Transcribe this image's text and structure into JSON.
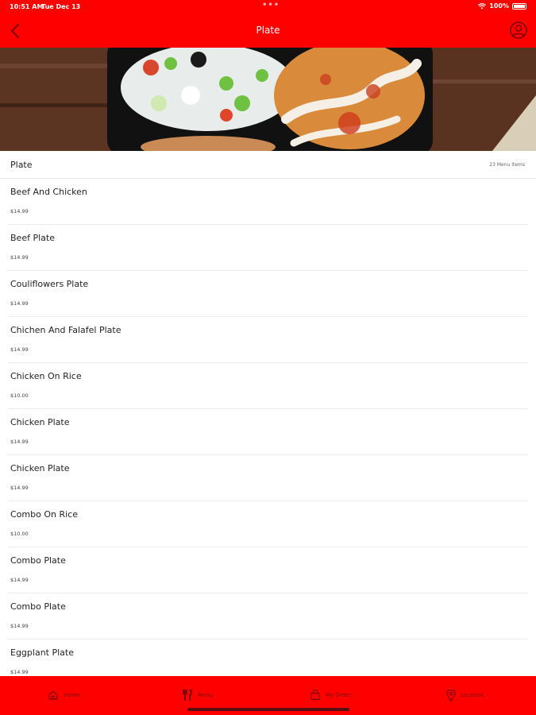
{
  "status_bar": {
    "time": "10:51 AM",
    "date": "Tue Dec 13",
    "battery": "100%"
  },
  "nav": {
    "title": "Plate"
  },
  "section": {
    "name": "Plate",
    "count": "23 Menu Items"
  },
  "menu_items": [
    {
      "name": "Beef And Chicken",
      "price": "$14.99"
    },
    {
      "name": "Beef Plate",
      "price": "$14.99"
    },
    {
      "name": "Couliflowers Plate",
      "price": "$14.99"
    },
    {
      "name": "Chichen And Falafel Plate",
      "price": "$14.99"
    },
    {
      "name": "Chicken On Rice",
      "price": "$10.00"
    },
    {
      "name": "Chicken Plate",
      "price": "$14.99"
    },
    {
      "name": "Chicken Plate",
      "price": "$14.99"
    },
    {
      "name": "Combo On Rice",
      "price": "$10.00"
    },
    {
      "name": "Combo Plate",
      "price": "$14.99"
    },
    {
      "name": "Combo Plate",
      "price": "$14.99"
    },
    {
      "name": "Eggplant Plate",
      "price": "$14.99"
    }
  ],
  "tabs": [
    {
      "label": "Home",
      "icon": "home-icon"
    },
    {
      "label": "Menu",
      "icon": "fork-knife-icon"
    },
    {
      "label": "My Order",
      "icon": "shopping-bag-icon"
    },
    {
      "label": "Location",
      "icon": "location-pin-icon"
    }
  ],
  "colors": {
    "brand_red": "#ff0000",
    "tab_text": "#7a0000"
  }
}
